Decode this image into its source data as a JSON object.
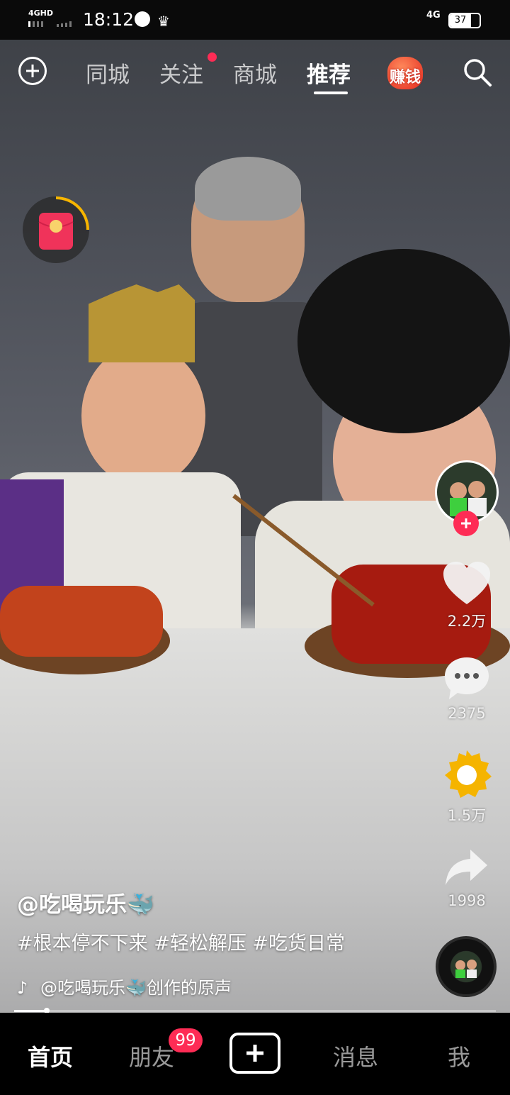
{
  "status_bar": {
    "network_left": "4GHD",
    "time": "18:12",
    "network_right": "4G",
    "battery": "37"
  },
  "top_nav": {
    "tabs": [
      "同城",
      "关注",
      "商城",
      "推荐"
    ],
    "active_tab": "推荐",
    "earn_label": "赚钱"
  },
  "actions": {
    "likes": "2.2万",
    "comments": "2375",
    "favorites": "1.5万",
    "shares": "1998"
  },
  "caption": {
    "author": "@吃喝玩乐🐳",
    "hashtags": "#根本停不下来 #轻松解压 #吃货日常",
    "music": "@吃喝玩乐🐳创作的原声"
  },
  "playback": {
    "progress": 0.067
  },
  "bottom_tabs": {
    "home": "首页",
    "friends": "朋友",
    "friends_badge": "99",
    "messages": "消息",
    "me": "我"
  },
  "colors": {
    "accent": "#fe2c55",
    "favorite": "#f5b400",
    "timer_ring": "#f7b500"
  }
}
